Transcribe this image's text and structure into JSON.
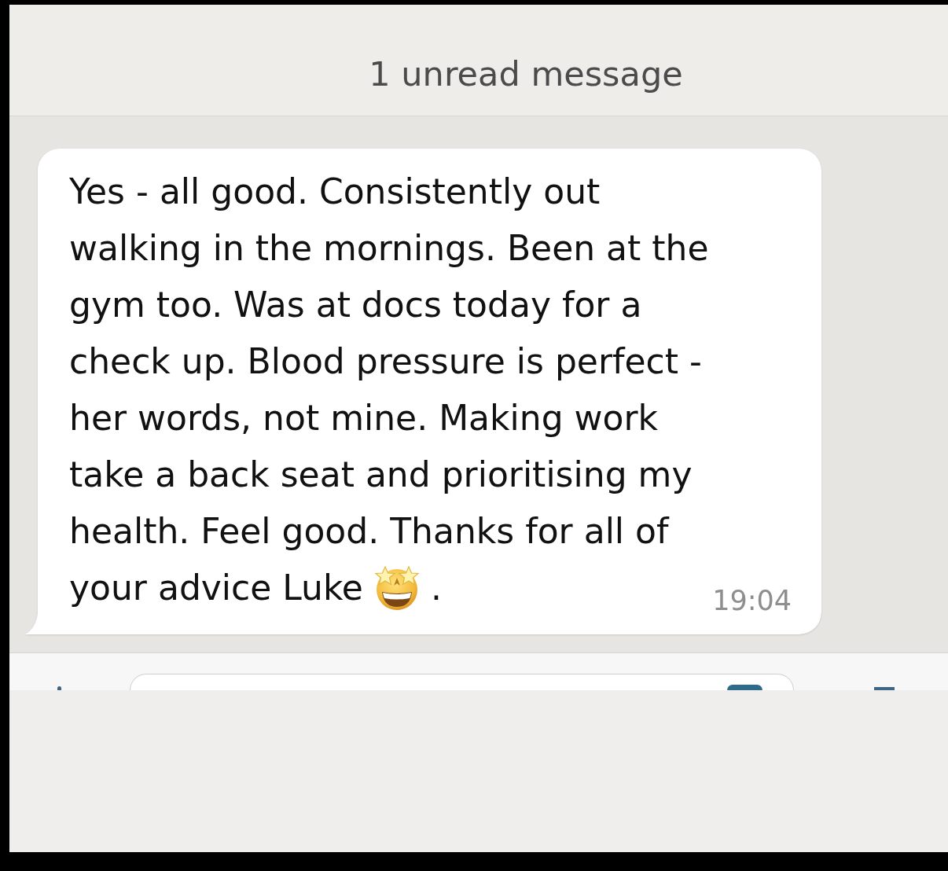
{
  "unread_banner": {
    "text": "1 unread message"
  },
  "message": {
    "text": "Yes - all good. Consistently out walking in the mornings. Been at the gym too. Was at docs today for a check up. Blood pressure is perfect - her words, not mine. Making work take a back seat and prioritising my health. Feel good. Thanks for all of your advice Luke",
    "text_after_emoji": ".",
    "time": "19:04"
  }
}
